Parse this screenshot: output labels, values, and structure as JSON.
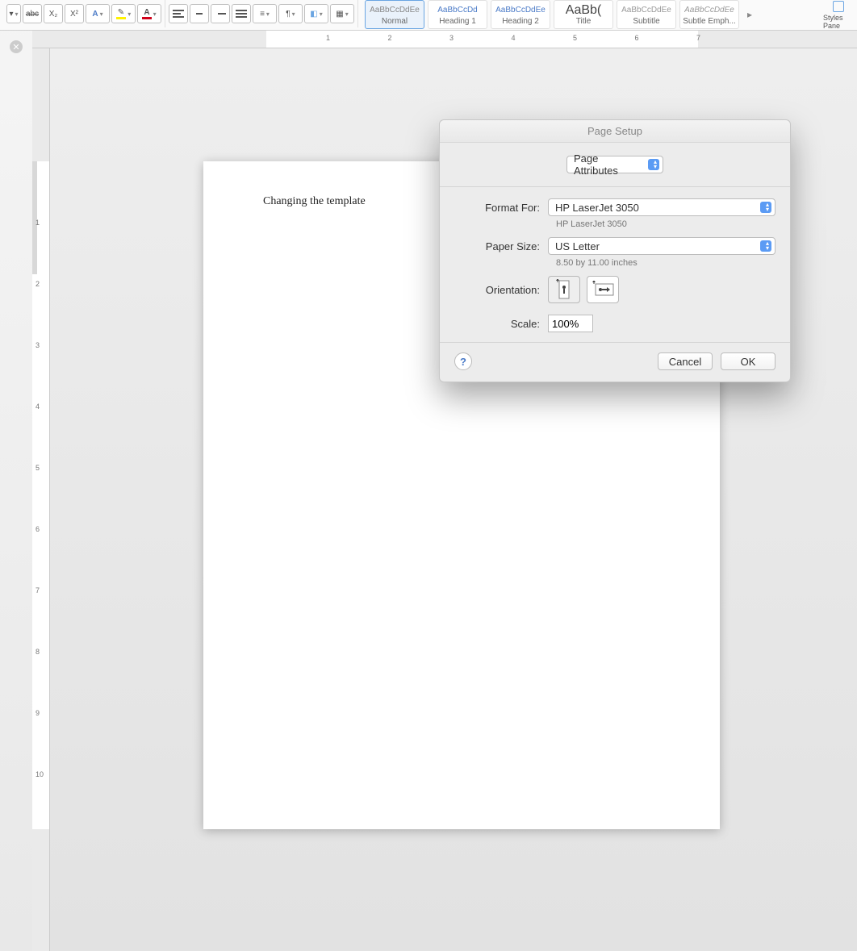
{
  "toolbar": {
    "strike": "abc",
    "subscript": "X₂",
    "superscript": "X²",
    "text_effects": "A",
    "highlight": "✎",
    "font_color": "A"
  },
  "paragraph": {
    "align_left": "left",
    "align_center": "center",
    "align_right": "right",
    "justify": "justify",
    "bullets_label": "•",
    "numbering_label": "1",
    "line_spacing": "↕",
    "shading": "paint",
    "no_spacing": "|||"
  },
  "styles": {
    "items": [
      {
        "preview": "AaBbCcDdEe",
        "label": "Normal",
        "cls": "",
        "selected": true
      },
      {
        "preview": "AaBbCcDd",
        "label": "Heading 1",
        "cls": "blue",
        "selected": false
      },
      {
        "preview": "AaBbCcDdEe",
        "label": "Heading 2",
        "cls": "blue",
        "selected": false
      },
      {
        "preview": "AaBb(",
        "label": "Title",
        "cls": "big",
        "selected": false
      },
      {
        "preview": "AaBbCcDdEe",
        "label": "Subtitle",
        "cls": "gray",
        "selected": false
      },
      {
        "preview": "AaBbCcDdEe",
        "label": "Subtle Emph...",
        "cls": "italic gray",
        "selected": false
      }
    ],
    "pane_label": "Styles Pane"
  },
  "ruler": {
    "h_numbers": [
      "1",
      "2",
      "3",
      "4",
      "5",
      "6",
      "7"
    ]
  },
  "document": {
    "text": "Changing the template"
  },
  "dialog": {
    "title": "Page Setup",
    "dropdown_top": "Page Attributes",
    "format_for_label": "Format For:",
    "format_for_value": "HP LaserJet 3050",
    "printer_sub": "HP LaserJet 3050",
    "paper_size_label": "Paper Size:",
    "paper_size_value": "US Letter",
    "paper_dims": "8.50 by 11.00 inches",
    "orientation_label": "Orientation:",
    "scale_label": "Scale:",
    "scale_value": "100%",
    "help": "?",
    "cancel": "Cancel",
    "ok": "OK"
  }
}
